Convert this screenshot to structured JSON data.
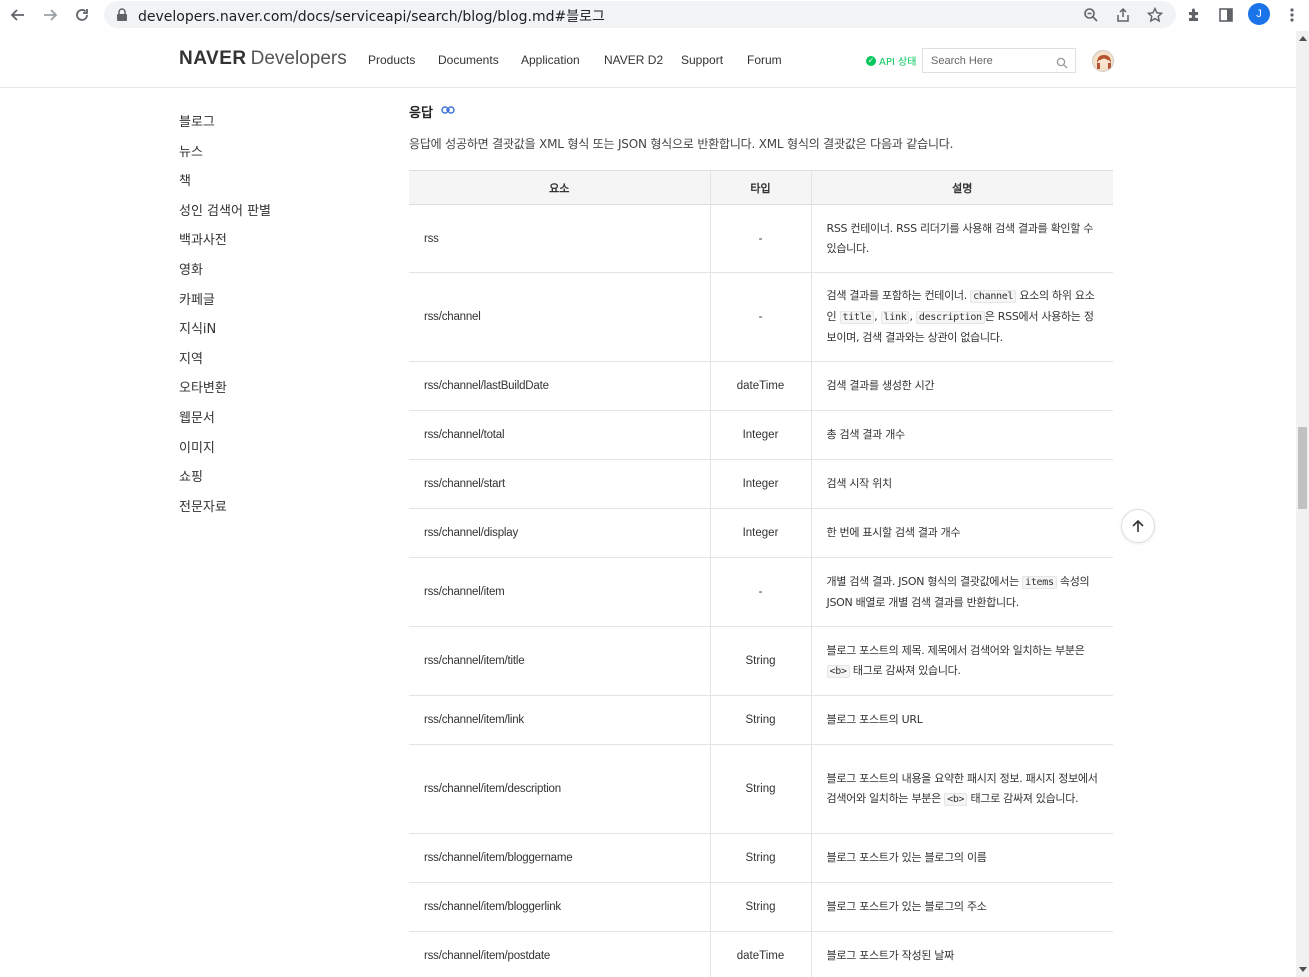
{
  "browser": {
    "url": "developers.naver.com/docs/serviceapi/search/blog/blog.md#블로그",
    "profile_initial": "J"
  },
  "header": {
    "logo_brand": "NAVER",
    "logo_product": "Developers",
    "menu": [
      "Products",
      "Documents",
      "Application",
      "NAVER D2",
      "Support",
      "Forum"
    ],
    "api_status": "API 상태",
    "search_placeholder": "Search Here"
  },
  "sidebar": {
    "items": [
      "블로그",
      "뉴스",
      "책",
      "성인 검색어 판별",
      "백과사전",
      "영화",
      "카페글",
      "지식iN",
      "지역",
      "오타변환",
      "웹문서",
      "이미지",
      "쇼핑",
      "전문자료"
    ]
  },
  "main": {
    "section_title": "응답",
    "intro": "응답에 성공하면 결괏값을 XML 형식 또는 JSON 형식으로 반환합니다. XML 형식의 결괏값은 다음과 같습니다.",
    "table": {
      "headers": [
        "요소",
        "타입",
        "설명"
      ],
      "rows": [
        {
          "element": "rss",
          "type": "-",
          "desc": [
            "RSS 컨테이너. RSS 리더기를 사용해 검색 결과를 확인할 수 있습니다."
          ]
        },
        {
          "element": "rss/channel",
          "type": "-",
          "desc": [
            "검색 결과를 포함하는 컨테이너. ",
            "channel",
            " 요소의 하위 요소인 ",
            "title",
            ", ",
            "link",
            ", ",
            "description",
            "은 RSS에서 사용하는 정보이며, 검색 결과와는 상관이 없습니다."
          ]
        },
        {
          "element": "rss/channel/lastBuildDate",
          "type": "dateTime",
          "desc": [
            "검색 결과를 생성한 시간"
          ]
        },
        {
          "element": "rss/channel/total",
          "type": "Integer",
          "desc": [
            "총 검색 결과 개수"
          ]
        },
        {
          "element": "rss/channel/start",
          "type": "Integer",
          "desc": [
            "검색 시작 위치"
          ]
        },
        {
          "element": "rss/channel/display",
          "type": "Integer",
          "desc": [
            "한 번에 표시할 검색 결과 개수"
          ]
        },
        {
          "element": "rss/channel/item",
          "type": "-",
          "desc": [
            "개별 검색 결과. JSON 형식의 결괏값에서는 ",
            "items",
            " 속성의 JSON 배열로 개별 검색 결과를 반환합니다."
          ]
        },
        {
          "element": "rss/channel/item/title",
          "type": "String",
          "desc": [
            "블로그 포스트의 제목. 제목에서 검색어와 일치하는 부분은 ",
            "<b>",
            " 태그로 감싸져 있습니다."
          ]
        },
        {
          "element": "rss/channel/item/link",
          "type": "String",
          "desc": [
            "블로그 포스트의 URL"
          ]
        },
        {
          "element": "rss/channel/item/description",
          "type": "String",
          "desc": [
            "블로그 포스트의 내용을 요약한 패시지 정보. 패시지 정보에서 검색어와 일치하는 부분은 ",
            "<b>",
            " 태그로 감싸져 있습니다."
          ]
        },
        {
          "element": "rss/channel/item/bloggername",
          "type": "String",
          "desc": [
            "블로그 포스트가 있는 블로그의 이름"
          ]
        },
        {
          "element": "rss/channel/item/bloggerlink",
          "type": "String",
          "desc": [
            "블로그 포스트가 있는 블로그의 주소"
          ]
        },
        {
          "element": "rss/channel/item/postdate",
          "type": "dateTime",
          "desc": [
            "블로그 포스트가 작성된 날짜"
          ]
        }
      ]
    }
  }
}
